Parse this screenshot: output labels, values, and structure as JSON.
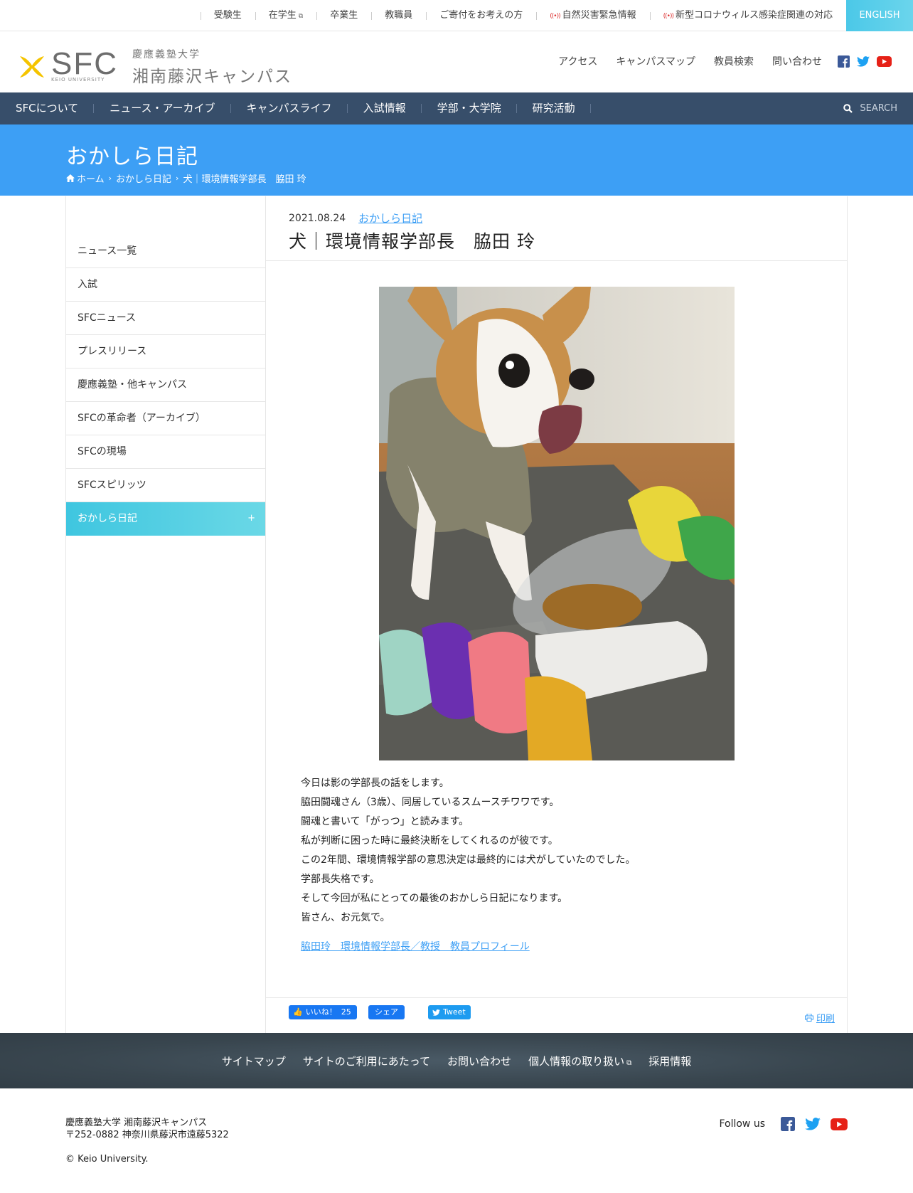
{
  "utility": {
    "items": [
      "受験生",
      "在学生",
      "卒業生",
      "教職員",
      "ご寄付をお考えの方",
      "自然災害緊急情報",
      "新型コロナウィルス感染症関連の対応"
    ],
    "english": "ENGLISH"
  },
  "header": {
    "logo_mark": "SFC",
    "logo_sub": "KEIO UNIVERSITY",
    "logo_jp1": "慶應義塾大学",
    "logo_jp2": "湘南藤沢キャンパス",
    "links": [
      "アクセス",
      "キャンパスマップ",
      "教員検索",
      "問い合わせ"
    ]
  },
  "nav": {
    "items": [
      "SFCについて",
      "ニュース・アーカイブ",
      "キャンパスライフ",
      "入試情報",
      "学部・大学院",
      "研究活動"
    ],
    "search": "SEARCH"
  },
  "pagehead": {
    "title": "おかしら日記",
    "breadcrumb": [
      "ホーム",
      "おかしら日記",
      "犬｜環境情報学部長　脇田 玲"
    ]
  },
  "sidebar": {
    "items": [
      "ニュース一覧",
      "入試",
      "SFCニュース",
      "プレスリリース",
      "慶應義塾・他キャンパス",
      "SFCの革命者（アーカイブ）",
      "SFCの現場",
      "SFCスピリッツ",
      "おかしら日記"
    ],
    "active_plus": "+"
  },
  "article": {
    "date": "2021.08.24",
    "category": "おかしら日記",
    "title": "犬｜環境情報学部長　脇田 玲",
    "image_alt": "チワワ",
    "paragraphs": [
      "今日は影の学部長の話をします。",
      "脇田闘魂さん（3歳）、同居しているスムースチワワです。",
      "闘魂と書いて「がっつ」と読みます。",
      "私が判断に困った時に最終決断をしてくれるのが彼です。",
      "この2年間、環境情報学部の意思決定は最終的には犬がしていたのでした。",
      "学部長失格です。",
      "そして今回が私にとっての最後のおかしら日記になります。",
      "皆さん、お元気で。"
    ],
    "profile_link": "脇田玲　環境情報学部長／教授　教員プロフィール"
  },
  "share": {
    "like_label": "いいね！",
    "like_count": "25",
    "share_label": "シェア",
    "tweet_label": "Tweet",
    "print_label": "印刷"
  },
  "footer": {
    "nav": [
      "サイトマップ",
      "サイトのご利用にあたって",
      "お問い合わせ",
      "個人情報の取り扱い",
      "採用情報"
    ],
    "address_line1": "慶應義塾大学 湘南藤沢キャンパス",
    "address_line2": "〒252-0882 神奈川県藤沢市遠藤5322",
    "copyright": "© Keio University.",
    "follow_label": "Follow us"
  },
  "colors": {
    "nav_bg": "#374e6a",
    "pagehead_bg": "#3d9ff5",
    "accent_cyan": "#4bc8e8",
    "link": "#3d9ff5",
    "logo_yellow": "#f5c400"
  }
}
